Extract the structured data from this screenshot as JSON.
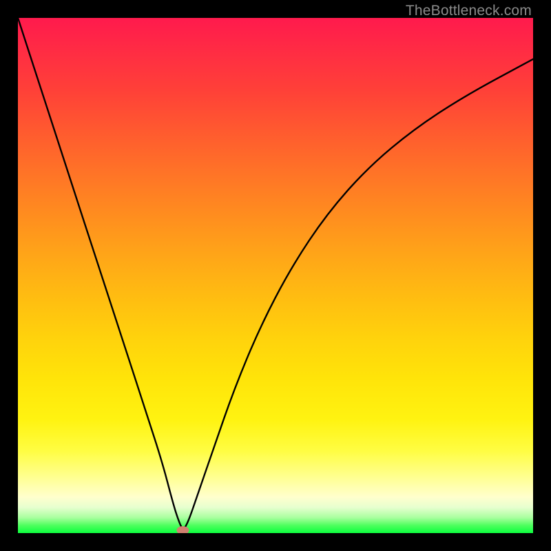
{
  "watermark": "TheBottleneck.com",
  "chart_data": {
    "type": "line",
    "title": "",
    "xlabel": "",
    "ylabel": "",
    "xlim": [
      0,
      1
    ],
    "ylim": [
      0,
      1
    ],
    "series": [
      {
        "name": "curve",
        "x": [
          0.0,
          0.05,
          0.1,
          0.15,
          0.2,
          0.25,
          0.28,
          0.3,
          0.31,
          0.32,
          0.33,
          0.35,
          0.38,
          0.42,
          0.47,
          0.53,
          0.6,
          0.68,
          0.77,
          0.87,
          1.0
        ],
        "y": [
          1.0,
          0.846,
          0.692,
          0.538,
          0.385,
          0.231,
          0.138,
          0.062,
          0.029,
          0.005,
          0.02,
          0.078,
          0.165,
          0.28,
          0.4,
          0.515,
          0.62,
          0.71,
          0.785,
          0.85,
          0.92
        ]
      }
    ],
    "marker": {
      "x": 0.32,
      "y": 0.0,
      "color": "#d0806f"
    },
    "gradient_stops": [
      {
        "pos": 0.0,
        "color": "#ff1a4d"
      },
      {
        "pos": 0.5,
        "color": "#ffbc11"
      },
      {
        "pos": 0.9,
        "color": "#ffffcd"
      },
      {
        "pos": 1.0,
        "color": "#0cff3e"
      }
    ]
  }
}
